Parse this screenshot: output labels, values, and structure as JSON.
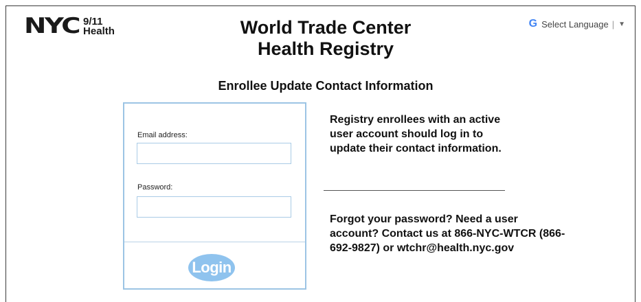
{
  "header": {
    "logo": {
      "wordmark": "NYC",
      "sub_line1": "9/11",
      "sub_line2": "Health"
    },
    "title_line1": "World Trade Center",
    "title_line2": "Health Registry",
    "language": {
      "icon": "google-g-icon",
      "g_glyph": "G",
      "label": "Select Language",
      "separator": "|",
      "arrow": "▼"
    }
  },
  "page": {
    "subtitle": "Enrollee Update Contact Information"
  },
  "login_form": {
    "email_label": "Email address:",
    "email_value": "",
    "password_label": "Password:",
    "password_value": "",
    "login_button_label": "Login"
  },
  "info": {
    "enrollee_text": "Registry enrollees with an active user account should log in to update their contact information.",
    "contact_text": "Forgot your password? Need a user account? Contact us at 866-NYC-WTCR (866-692-9827) or wtchr@health.nyc.gov"
  },
  "colors": {
    "accent_blue": "#8fc3ee",
    "box_border": "#9cc4e4",
    "text": "#111111"
  }
}
